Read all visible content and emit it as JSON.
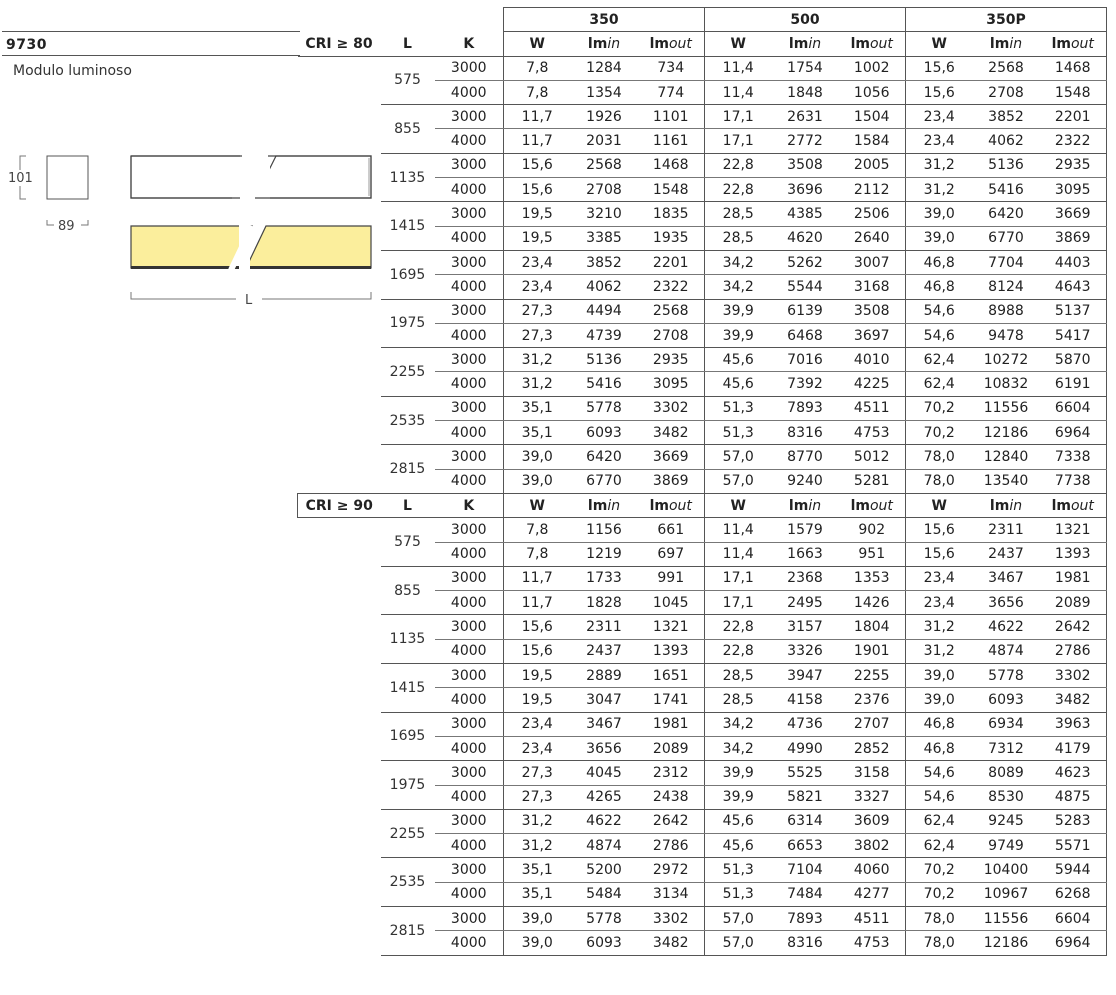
{
  "product": {
    "code": "9730",
    "subtitle": "Modulo luminoso"
  },
  "dimensions": {
    "height_label": "101",
    "width_label": "89",
    "length_label": "L",
    "panel_color": "#fbee9c"
  },
  "table": {
    "groups": [
      "350",
      "500",
      "350P"
    ],
    "col_headers": {
      "L": "L",
      "K": "K",
      "W": "W",
      "lm": "lm",
      "in": "in",
      "out": "out"
    },
    "sections": [
      {
        "cri_label": "CRI ≥ 80",
        "rows": [
          {
            "L": "575",
            "temps": [
              {
                "K": "3000",
                "vals": [
                  "7,8",
                  "1284",
                  "734",
                  "11,4",
                  "1754",
                  "1002",
                  "15,6",
                  "2568",
                  "1468"
                ]
              },
              {
                "K": "4000",
                "vals": [
                  "7,8",
                  "1354",
                  "774",
                  "11,4",
                  "1848",
                  "1056",
                  "15,6",
                  "2708",
                  "1548"
                ]
              }
            ]
          },
          {
            "L": "855",
            "temps": [
              {
                "K": "3000",
                "vals": [
                  "11,7",
                  "1926",
                  "1101",
                  "17,1",
                  "2631",
                  "1504",
                  "23,4",
                  "3852",
                  "2201"
                ]
              },
              {
                "K": "4000",
                "vals": [
                  "11,7",
                  "2031",
                  "1161",
                  "17,1",
                  "2772",
                  "1584",
                  "23,4",
                  "4062",
                  "2322"
                ]
              }
            ]
          },
          {
            "L": "1135",
            "temps": [
              {
                "K": "3000",
                "vals": [
                  "15,6",
                  "2568",
                  "1468",
                  "22,8",
                  "3508",
                  "2005",
                  "31,2",
                  "5136",
                  "2935"
                ]
              },
              {
                "K": "4000",
                "vals": [
                  "15,6",
                  "2708",
                  "1548",
                  "22,8",
                  "3696",
                  "2112",
                  "31,2",
                  "5416",
                  "3095"
                ]
              }
            ]
          },
          {
            "L": "1415",
            "temps": [
              {
                "K": "3000",
                "vals": [
                  "19,5",
                  "3210",
                  "1835",
                  "28,5",
                  "4385",
                  "2506",
                  "39,0",
                  "6420",
                  "3669"
                ]
              },
              {
                "K": "4000",
                "vals": [
                  "19,5",
                  "3385",
                  "1935",
                  "28,5",
                  "4620",
                  "2640",
                  "39,0",
                  "6770",
                  "3869"
                ]
              }
            ]
          },
          {
            "L": "1695",
            "temps": [
              {
                "K": "3000",
                "vals": [
                  "23,4",
                  "3852",
                  "2201",
                  "34,2",
                  "5262",
                  "3007",
                  "46,8",
                  "7704",
                  "4403"
                ]
              },
              {
                "K": "4000",
                "vals": [
                  "23,4",
                  "4062",
                  "2322",
                  "34,2",
                  "5544",
                  "3168",
                  "46,8",
                  "8124",
                  "4643"
                ]
              }
            ]
          },
          {
            "L": "1975",
            "temps": [
              {
                "K": "3000",
                "vals": [
                  "27,3",
                  "4494",
                  "2568",
                  "39,9",
                  "6139",
                  "3508",
                  "54,6",
                  "8988",
                  "5137"
                ]
              },
              {
                "K": "4000",
                "vals": [
                  "27,3",
                  "4739",
                  "2708",
                  "39,9",
                  "6468",
                  "3697",
                  "54,6",
                  "9478",
                  "5417"
                ]
              }
            ]
          },
          {
            "L": "2255",
            "temps": [
              {
                "K": "3000",
                "vals": [
                  "31,2",
                  "5136",
                  "2935",
                  "45,6",
                  "7016",
                  "4010",
                  "62,4",
                  "10272",
                  "5870"
                ]
              },
              {
                "K": "4000",
                "vals": [
                  "31,2",
                  "5416",
                  "3095",
                  "45,6",
                  "7392",
                  "4225",
                  "62,4",
                  "10832",
                  "6191"
                ]
              }
            ]
          },
          {
            "L": "2535",
            "temps": [
              {
                "K": "3000",
                "vals": [
                  "35,1",
                  "5778",
                  "3302",
                  "51,3",
                  "7893",
                  "4511",
                  "70,2",
                  "11556",
                  "6604"
                ]
              },
              {
                "K": "4000",
                "vals": [
                  "35,1",
                  "6093",
                  "3482",
                  "51,3",
                  "8316",
                  "4753",
                  "70,2",
                  "12186",
                  "6964"
                ]
              }
            ]
          },
          {
            "L": "2815",
            "temps": [
              {
                "K": "3000",
                "vals": [
                  "39,0",
                  "6420",
                  "3669",
                  "57,0",
                  "8770",
                  "5012",
                  "78,0",
                  "12840",
                  "7338"
                ]
              },
              {
                "K": "4000",
                "vals": [
                  "39,0",
                  "6770",
                  "3869",
                  "57,0",
                  "9240",
                  "5281",
                  "78,0",
                  "13540",
                  "7738"
                ]
              }
            ]
          }
        ]
      },
      {
        "cri_label": "CRI ≥ 90",
        "rows": [
          {
            "L": "575",
            "temps": [
              {
                "K": "3000",
                "vals": [
                  "7,8",
                  "1156",
                  "661",
                  "11,4",
                  "1579",
                  "902",
                  "15,6",
                  "2311",
                  "1321"
                ]
              },
              {
                "K": "4000",
                "vals": [
                  "7,8",
                  "1219",
                  "697",
                  "11,4",
                  "1663",
                  "951",
                  "15,6",
                  "2437",
                  "1393"
                ]
              }
            ]
          },
          {
            "L": "855",
            "temps": [
              {
                "K": "3000",
                "vals": [
                  "11,7",
                  "1733",
                  "991",
                  "17,1",
                  "2368",
                  "1353",
                  "23,4",
                  "3467",
                  "1981"
                ]
              },
              {
                "K": "4000",
                "vals": [
                  "11,7",
                  "1828",
                  "1045",
                  "17,1",
                  "2495",
                  "1426",
                  "23,4",
                  "3656",
                  "2089"
                ]
              }
            ]
          },
          {
            "L": "1135",
            "temps": [
              {
                "K": "3000",
                "vals": [
                  "15,6",
                  "2311",
                  "1321",
                  "22,8",
                  "3157",
                  "1804",
                  "31,2",
                  "4622",
                  "2642"
                ]
              },
              {
                "K": "4000",
                "vals": [
                  "15,6",
                  "2437",
                  "1393",
                  "22,8",
                  "3326",
                  "1901",
                  "31,2",
                  "4874",
                  "2786"
                ]
              }
            ]
          },
          {
            "L": "1415",
            "temps": [
              {
                "K": "3000",
                "vals": [
                  "19,5",
                  "2889",
                  "1651",
                  "28,5",
                  "3947",
                  "2255",
                  "39,0",
                  "5778",
                  "3302"
                ]
              },
              {
                "K": "4000",
                "vals": [
                  "19,5",
                  "3047",
                  "1741",
                  "28,5",
                  "4158",
                  "2376",
                  "39,0",
                  "6093",
                  "3482"
                ]
              }
            ]
          },
          {
            "L": "1695",
            "temps": [
              {
                "K": "3000",
                "vals": [
                  "23,4",
                  "3467",
                  "1981",
                  "34,2",
                  "4736",
                  "2707",
                  "46,8",
                  "6934",
                  "3963"
                ]
              },
              {
                "K": "4000",
                "vals": [
                  "23,4",
                  "3656",
                  "2089",
                  "34,2",
                  "4990",
                  "2852",
                  "46,8",
                  "7312",
                  "4179"
                ]
              }
            ]
          },
          {
            "L": "1975",
            "temps": [
              {
                "K": "3000",
                "vals": [
                  "27,3",
                  "4045",
                  "2312",
                  "39,9",
                  "5525",
                  "3158",
                  "54,6",
                  "8089",
                  "4623"
                ]
              },
              {
                "K": "4000",
                "vals": [
                  "27,3",
                  "4265",
                  "2438",
                  "39,9",
                  "5821",
                  "3327",
                  "54,6",
                  "8530",
                  "4875"
                ]
              }
            ]
          },
          {
            "L": "2255",
            "temps": [
              {
                "K": "3000",
                "vals": [
                  "31,2",
                  "4622",
                  "2642",
                  "45,6",
                  "6314",
                  "3609",
                  "62,4",
                  "9245",
                  "5283"
                ]
              },
              {
                "K": "4000",
                "vals": [
                  "31,2",
                  "4874",
                  "2786",
                  "45,6",
                  "6653",
                  "3802",
                  "62,4",
                  "9749",
                  "5571"
                ]
              }
            ]
          },
          {
            "L": "2535",
            "temps": [
              {
                "K": "3000",
                "vals": [
                  "35,1",
                  "5200",
                  "2972",
                  "51,3",
                  "7104",
                  "4060",
                  "70,2",
                  "10400",
                  "5944"
                ]
              },
              {
                "K": "4000",
                "vals": [
                  "35,1",
                  "5484",
                  "3134",
                  "51,3",
                  "7484",
                  "4277",
                  "70,2",
                  "10967",
                  "6268"
                ]
              }
            ]
          },
          {
            "L": "2815",
            "temps": [
              {
                "K": "3000",
                "vals": [
                  "39,0",
                  "5778",
                  "3302",
                  "57,0",
                  "7893",
                  "4511",
                  "78,0",
                  "11556",
                  "6604"
                ]
              },
              {
                "K": "4000",
                "vals": [
                  "39,0",
                  "6093",
                  "3482",
                  "57,0",
                  "8316",
                  "4753",
                  "78,0",
                  "12186",
                  "6964"
                ]
              }
            ]
          }
        ]
      }
    ]
  }
}
